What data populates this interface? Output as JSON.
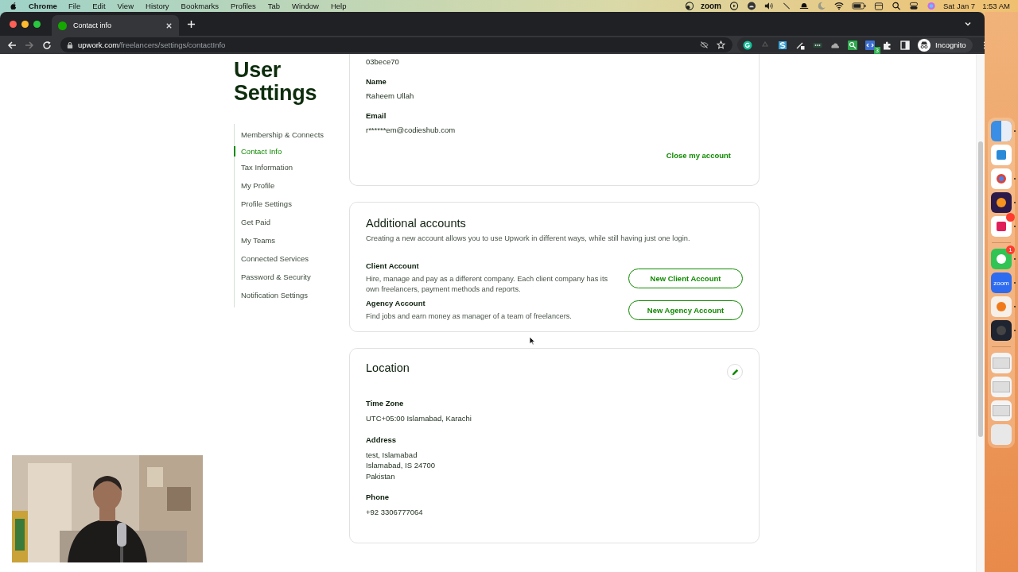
{
  "menu_bar": {
    "app": "Chrome",
    "menus": [
      "File",
      "Edit",
      "View",
      "History",
      "Bookmarks",
      "Profiles",
      "Tab",
      "Window",
      "Help"
    ],
    "zoom_label": "zoom",
    "date": "Sat Jan 7",
    "time": "1:53 AM"
  },
  "browser": {
    "tabs": [
      {
        "title": "Contact info",
        "selected": true
      }
    ],
    "address": {
      "domain": "upwork.com",
      "path": "/freelancers/settings/contactInfo"
    },
    "extension_badge": "3",
    "profile": "Incognito"
  },
  "sidebar": {
    "title": "User Settings",
    "items": [
      {
        "label": "Membership & Connects",
        "selected": false
      },
      {
        "label": "Contact Info",
        "selected": true
      },
      {
        "label": "Tax Information",
        "selected": false
      },
      {
        "label": "My Profile",
        "selected": false
      },
      {
        "label": "Profile Settings",
        "selected": false
      },
      {
        "label": "Get Paid",
        "selected": false
      },
      {
        "label": "My Teams",
        "selected": false
      },
      {
        "label": "Connected Services",
        "selected": false
      },
      {
        "label": "Password & Security",
        "selected": false
      },
      {
        "label": "Notification Settings",
        "selected": false
      }
    ]
  },
  "account_card": {
    "account_id": "03bece70",
    "fields": [
      {
        "label": "Name",
        "value": "Raheem Ullah"
      },
      {
        "label": "Email",
        "value": "r******em@codieshub.com"
      }
    ],
    "close_link": "Close my account"
  },
  "additional_accounts": {
    "title": "Additional accounts",
    "description": "Creating a new account allows you to use Upwork in different ways, while still having just one login.",
    "accounts": [
      {
        "title": "Client Account",
        "description": "Hire, manage and pay as a different company. Each client company has its own freelancers, payment methods and reports.",
        "button": "New Client Account"
      },
      {
        "title": "Agency Account",
        "description": "Find jobs and earn money as manager of a team of freelancers.",
        "button": "New Agency Account"
      }
    ]
  },
  "location": {
    "title": "Location",
    "fields": [
      {
        "label": "Time Zone",
        "lines": [
          "UTC+05:00 Islamabad, Karachi"
        ]
      },
      {
        "label": "Address",
        "lines": [
          "test, Islamabad",
          "Islamabad, IS 24700",
          "Pakistan"
        ]
      },
      {
        "label": "Phone",
        "lines": [
          "+92 3306777064"
        ]
      }
    ]
  },
  "dock": {
    "items": [
      {
        "kind": "finder",
        "running": true
      },
      {
        "kind": "code",
        "running": false
      },
      {
        "kind": "chrome",
        "running": true
      },
      {
        "kind": "firefox",
        "running": true
      },
      {
        "kind": "slack",
        "running": true,
        "badge": true
      },
      {
        "kind": "separator"
      },
      {
        "kind": "whatsapp",
        "running": true,
        "badge": true,
        "badge_text": "1"
      },
      {
        "kind": "zoom",
        "running": true,
        "label": "zoom"
      },
      {
        "kind": "player",
        "running": true
      },
      {
        "kind": "obs",
        "running": true
      },
      {
        "kind": "separator"
      },
      {
        "kind": "window"
      },
      {
        "kind": "window"
      },
      {
        "kind": "window"
      },
      {
        "kind": "trash"
      }
    ]
  }
}
